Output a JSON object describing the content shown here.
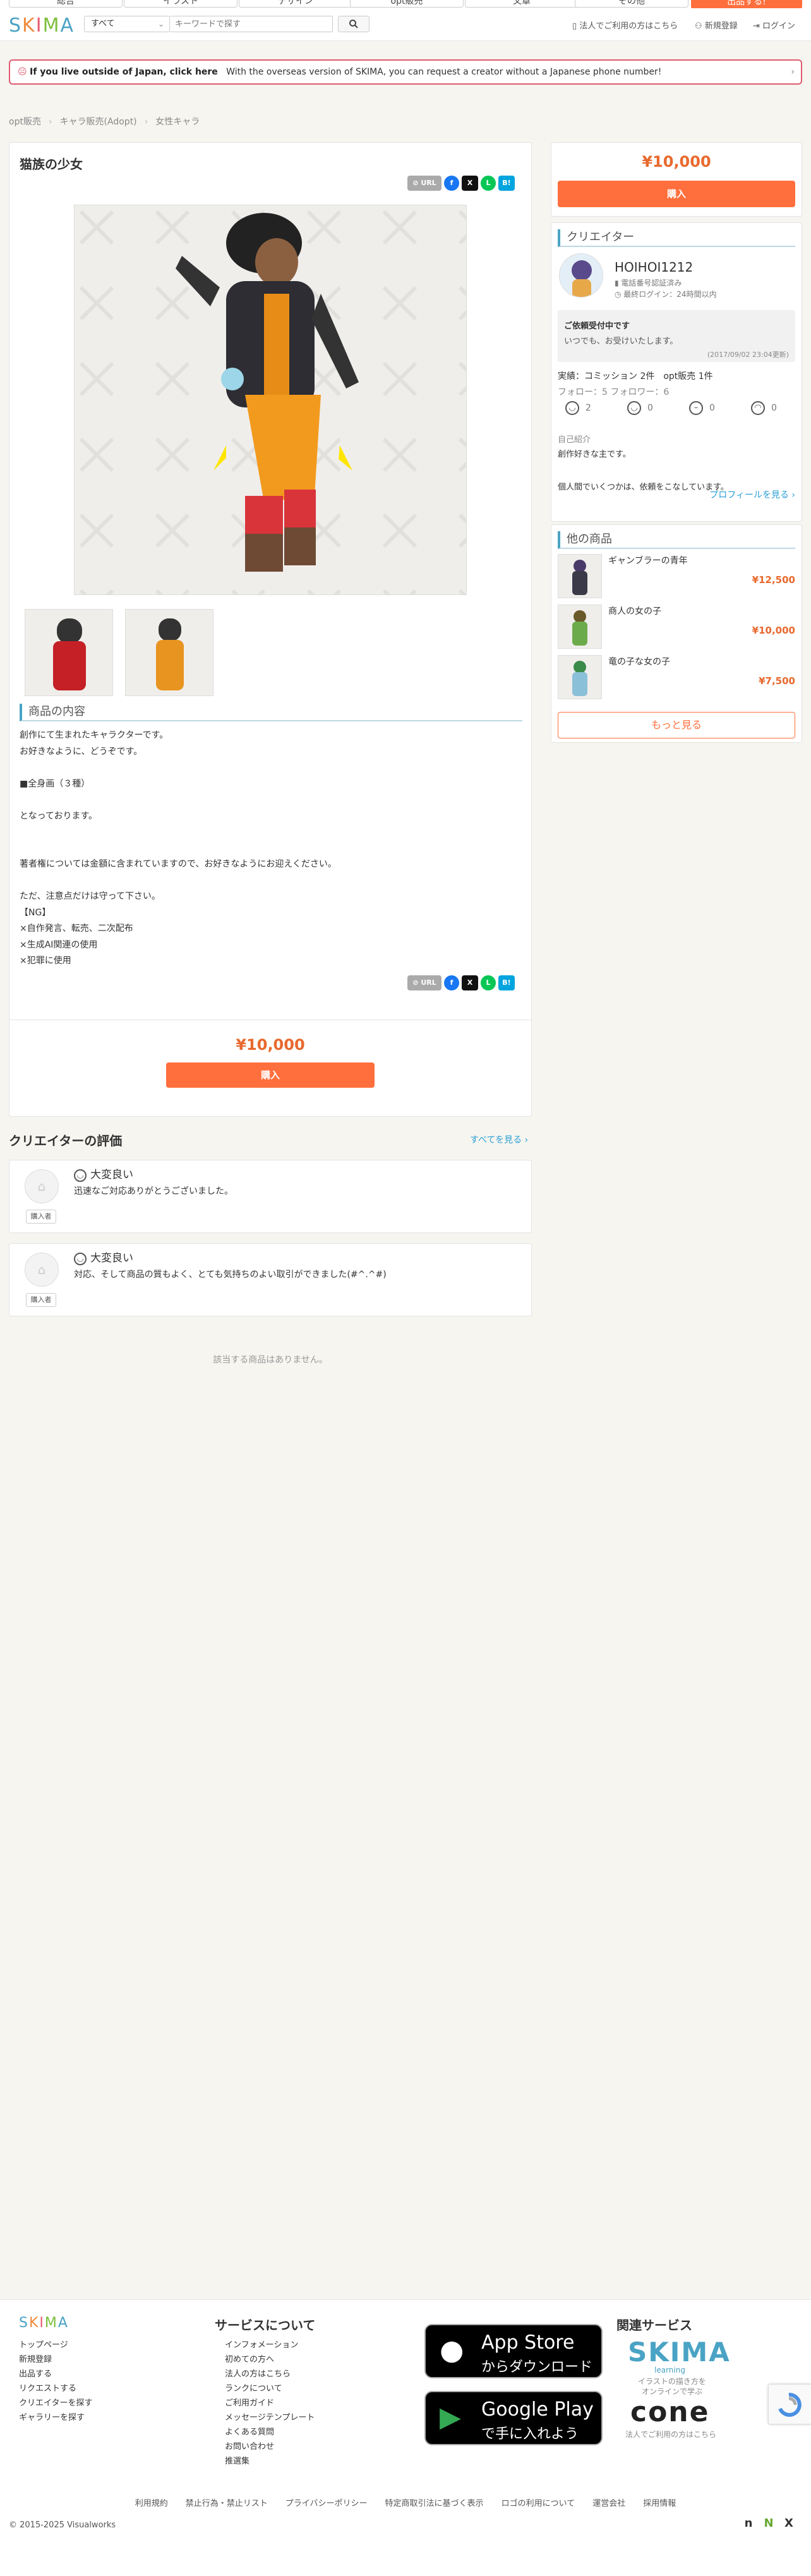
{
  "topnav": {
    "categories": [
      "総合",
      "イラスト",
      "デザイン",
      "opt販売",
      "文章",
      "その他"
    ],
    "sell_label": "出品する!"
  },
  "header": {
    "logo": "SKIMA",
    "select_value": "すべて",
    "search_placeholder": "キーワードで探す",
    "links": [
      "法人でご利用の方はこちら",
      "新規登録",
      "ログイン"
    ]
  },
  "notice": {
    "strong": "If you live outside of Japan, click here",
    "text": "With the overseas version of SKIMA, you can request a creator without a Japanese phone number!"
  },
  "breadcrumb": [
    "opt販売",
    "キャラ販売(Adopt)",
    "女性キャラ"
  ],
  "product": {
    "title": "猫族の少女",
    "url_label": "URL",
    "description_heading": "商品の内容",
    "description": "創作にて生まれたキャラクターです。\nお好きなように、どうぞです。\n\n■全身画（３種）\n\nとなっております。\n\n\n著者権については金額に含まれていますので、お好きなようにお迎えください。\n\nただ、注意点だけは守って下さい。\n【NG】\n×自作発言、転売、二次配布\n×生成AI関連の使用\n×犯罪に使用",
    "price": "¥10,000",
    "buy_label": "購入"
  },
  "creator": {
    "heading": "クリエイター",
    "name": "HOIHOI1212",
    "verified": "電話番号認証済み",
    "last_login": "最終ログイン：24時間以内",
    "request_title": "ご依頼受付中です",
    "request_text": "いつでも、お受けいたします。",
    "request_date": "(2017/09/02 23:04更新)",
    "stats": "実績：コミッション 2件　opt販売 1件",
    "follow": "フォロー：5 フォロワー：6",
    "ratings": [
      "2",
      "0",
      "0",
      "0"
    ],
    "intro_heading": "自己紹介",
    "intro_text": "創作好きな主です。\n\n個人間でいくつかは、依頼をこなしています。",
    "profile_link": "プロフィールを見る ›"
  },
  "others": {
    "heading": "他の商品",
    "items": [
      {
        "name": "ギャンブラーの青年",
        "price": "¥12,500"
      },
      {
        "name": "商人の女の子",
        "price": "¥10,000"
      },
      {
        "name": "竜の子な女の子",
        "price": "¥7,500"
      }
    ],
    "more_label": "もっと見る"
  },
  "reviews": {
    "heading": "クリエイターの評価",
    "view_all": "すべてを見る ›",
    "items": [
      {
        "level": "大変良い",
        "text": "迅速なご対応ありがとうございました。",
        "badge": "購入者"
      },
      {
        "level": "大変良い",
        "text": "対応、そして商品の質もよく、とても気持ちのよい取引ができました(#^.^#)",
        "badge": "購入者"
      }
    ],
    "no_match": "該当する商品はありません。"
  },
  "footer": {
    "logo": "SKIMA",
    "links_left": [
      "トップページ",
      "新規登録",
      "出品する",
      "リクエストする",
      "クリエイターを探す",
      "ギャラリーを探す"
    ],
    "service_heading": "サービスについて",
    "links_service": [
      "インフォメーション",
      "初めての方へ",
      "法人の方はこちら",
      "ランクについて",
      "ご利用ガイド",
      "メッセージテンプレート",
      "よくある質問",
      "お問い合わせ",
      "推選集"
    ],
    "appstore_l1": "App Store",
    "appstore_l2": "からダウンロード",
    "googleplay_l1": "Google Play",
    "googleplay_l2": "で手に入れよう",
    "related_heading": "関連サービス",
    "skima_learning": "SKIMA",
    "skima_learning_sub": "learning",
    "skima_learning_desc1": "イラストの描き方を",
    "skima_learning_desc2": "オンラインで学ぶ",
    "cone": "cone",
    "cone_desc": "法人でご利用の方はこちら",
    "legal": [
      "利用規約",
      "禁止行為・禁止リスト",
      "プライバシーポリシー",
      "特定商取引法に基づく表示",
      "ロゴの利用について",
      "運営会社",
      "採用情報"
    ],
    "copyright": "© 2015-2025 Visualworks"
  },
  "colors": {
    "accent": "#ff6f3d",
    "price": "#e8692e",
    "link": "#2a9fd6",
    "section": "#4aa3c4"
  }
}
